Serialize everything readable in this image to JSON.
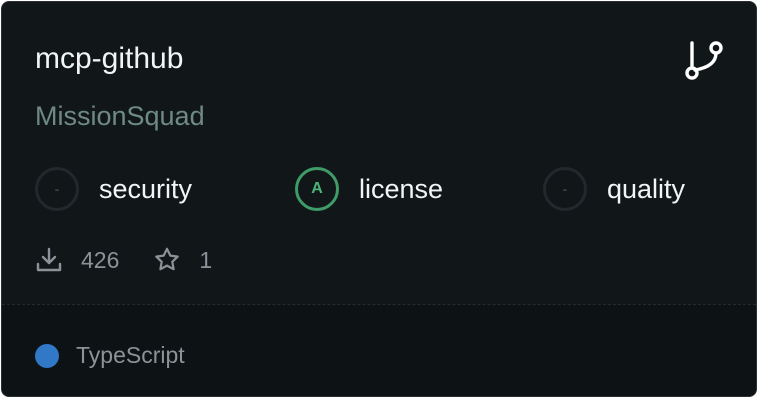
{
  "repo": {
    "name": "mcp-github",
    "owner": "MissionSquad",
    "icon": "git-branch-icon"
  },
  "scores": [
    {
      "label": "security",
      "grade": "-",
      "status": "none"
    },
    {
      "label": "license",
      "grade": "A",
      "status": "pass",
      "color": "#4bb37a"
    },
    {
      "label": "quality",
      "grade": "-",
      "status": "none"
    }
  ],
  "stats": {
    "downloads": "426",
    "downloads_icon": "download-icon",
    "stars": "1",
    "stars_icon": "star-icon"
  },
  "language": {
    "name": "TypeScript",
    "color": "#3178c6"
  }
}
